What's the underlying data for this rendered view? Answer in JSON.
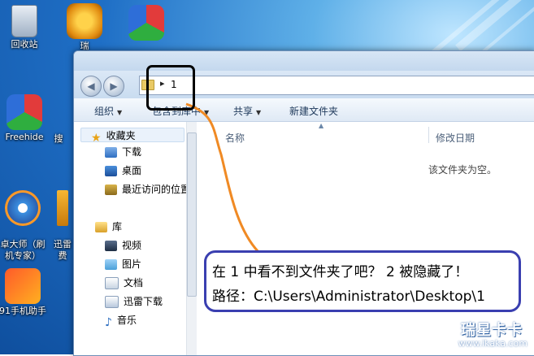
{
  "desktop": {
    "icons": [
      {
        "label": "回收站"
      },
      {
        "label": "瑞"
      },
      {
        "label": ""
      },
      {
        "label": "Freehide"
      },
      {
        "label": "搜"
      },
      {
        "label": "卓大师（刷\n机专家）"
      },
      {
        "label": "迅雷\n费"
      },
      {
        "label": "91手机助手"
      }
    ]
  },
  "window": {
    "address": {
      "crumb": "1"
    },
    "toolbar": {
      "organize": "组织",
      "include": "包含到库中",
      "share": "共享",
      "new_folder": "新建文件夹"
    },
    "sidebar": {
      "favorites": "收藏夹",
      "favorites_items": [
        "下载",
        "桌面",
        "最近访问的位置"
      ],
      "libraries": "库",
      "libraries_items": [
        "视频",
        "图片",
        "文档",
        "迅雷下载",
        "音乐"
      ]
    },
    "content": {
      "col_name": "名称",
      "col_date": "修改日期",
      "empty": "该文件夹为空。"
    }
  },
  "annotation": {
    "line1": "在 1 中看不到文件夹了吧？  2  被隐藏了！",
    "line2": "路径：C:\\Users\\Administrator\\Desktop\\1"
  },
  "watermark": {
    "brand": "瑞星卡卡",
    "url": "www.ikaka.com"
  },
  "colors": {
    "annotation_line": "#f08a24",
    "callout_border": "#3a3fb0"
  }
}
